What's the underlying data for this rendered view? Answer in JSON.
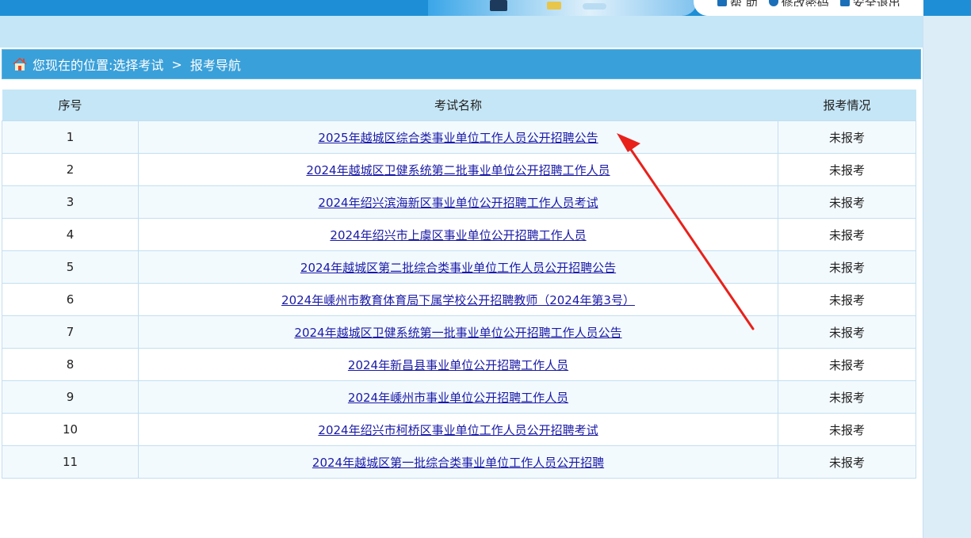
{
  "header": {
    "links": [
      {
        "label": "帮 助",
        "icon": "help-icon"
      },
      {
        "label": "修改密码",
        "icon": "key-icon"
      },
      {
        "label": "安全退出",
        "icon": "exit-icon"
      }
    ]
  },
  "breadcrumb": {
    "icon": "home-icon",
    "prefix": "您现在的位置:",
    "items": [
      "选择考试",
      "报考导航"
    ],
    "separator": ">"
  },
  "table": {
    "headers": [
      "序号",
      "考试名称",
      "报考情况"
    ],
    "rows": [
      {
        "no": "1",
        "name": "2025年越城区综合类事业单位工作人员公开招聘公告",
        "status": "未报考"
      },
      {
        "no": "2",
        "name": "2024年越城区卫健系统第二批事业单位公开招聘工作人员",
        "status": "未报考"
      },
      {
        "no": "3",
        "name": "2024年绍兴滨海新区事业单位公开招聘工作人员考试",
        "status": "未报考"
      },
      {
        "no": "4",
        "name": "2024年绍兴市上虞区事业单位公开招聘工作人员",
        "status": "未报考"
      },
      {
        "no": "5",
        "name": "2024年越城区第二批综合类事业单位工作人员公开招聘公告",
        "status": "未报考"
      },
      {
        "no": "6",
        "name": "2024年嵊州市教育体育局下属学校公开招聘教师（2024年第3号）",
        "status": "未报考"
      },
      {
        "no": "7",
        "name": "2024年越城区卫健系统第一批事业单位公开招聘工作人员公告",
        "status": "未报考"
      },
      {
        "no": "8",
        "name": "2024年新昌县事业单位公开招聘工作人员",
        "status": "未报考"
      },
      {
        "no": "9",
        "name": "2024年嵊州市事业单位公开招聘工作人员",
        "status": "未报考"
      },
      {
        "no": "10",
        "name": "2024年绍兴市柯桥区事业单位工作人员公开招聘考试",
        "status": "未报考"
      },
      {
        "no": "11",
        "name": "2024年越城区第一批综合类事业单位工作人员公开招聘",
        "status": "未报考"
      }
    ]
  },
  "annotation": {
    "icon": "red-arrow-icon",
    "color": "#e8211b"
  },
  "colors": {
    "topbar": "#1e8fd6",
    "subbar": "#c5e6f6",
    "breadcrumb": "#3aa0d9",
    "link": "#1a1aa6"
  }
}
